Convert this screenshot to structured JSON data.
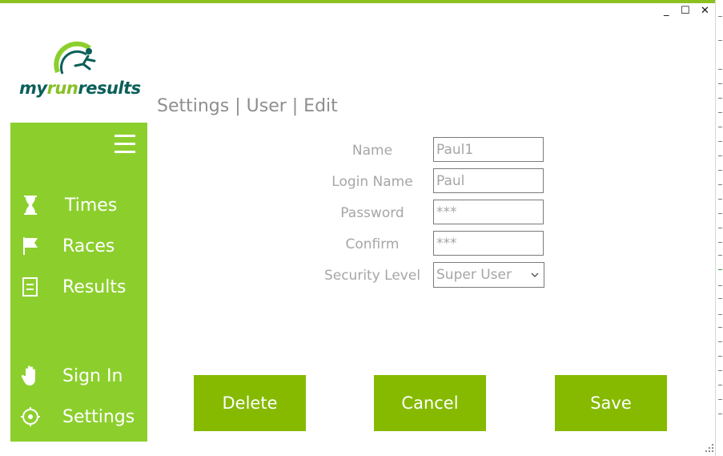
{
  "window": {
    "minimize_glyph": "_",
    "maximize_glyph": "☐",
    "close_glyph": "✕"
  },
  "brand": {
    "logo_part1": "my",
    "logo_part2": "run",
    "logo_part3": "results",
    "primary": "#8ccf2d",
    "dark": "#0b5f59",
    "button": "#85ba00"
  },
  "sidebar": {
    "menu_icon": "hamburger-icon",
    "items": [
      {
        "label": "Times",
        "icon": "hourglass-icon"
      },
      {
        "label": "Races",
        "icon": "flag-icon"
      },
      {
        "label": "Results",
        "icon": "document-icon"
      },
      {
        "label": "Sign In",
        "icon": "hand-icon"
      },
      {
        "label": "Settings",
        "icon": "gear-icon"
      }
    ]
  },
  "page": {
    "title": "Settings | User | Edit"
  },
  "form": {
    "name_label": "Name",
    "name_value": "Paul1",
    "login_label": "Login Name",
    "login_value": "Paul",
    "password_label": "Password",
    "password_value": "***",
    "confirm_label": "Confirm",
    "confirm_value": "***",
    "security_label": "Security Level",
    "security_value": "Super User"
  },
  "buttons": {
    "delete": "Delete",
    "cancel": "Cancel",
    "save": "Save"
  }
}
